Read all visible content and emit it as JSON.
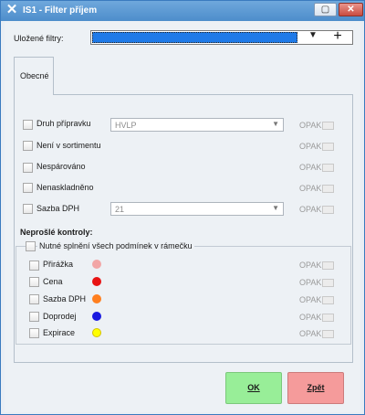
{
  "window": {
    "title": "IS1 - Filter příjem",
    "app_icon": "app-x-icon",
    "restore_icon": "restore-icon",
    "close_icon": "close-icon"
  },
  "saved_filters": {
    "label": "Uložené filtry:",
    "value": "",
    "dropdown_icon": "chevron-down-icon",
    "add_icon": "plus-icon"
  },
  "tabs": [
    {
      "label": "Obecné"
    }
  ],
  "opak_label": "OPAK",
  "general_filters": [
    {
      "label": "Druh přípravku",
      "combo": "HVLP"
    },
    {
      "label": "Není v sortimentu"
    },
    {
      "label": "Nespárováno"
    },
    {
      "label": "Nenaskladněno"
    },
    {
      "label": "Sazba DPH",
      "combo": "21"
    }
  ],
  "failed_checks": {
    "heading": "Neprošlé kontroly:",
    "group_label": "Nutné splnění všech podmínek v rámečku",
    "items": [
      {
        "label": "Přirážka",
        "color": "#f2a6a6"
      },
      {
        "label": "Cena",
        "color": "#e81313"
      },
      {
        "label": "Sazba DPH",
        "color": "#ff7f1f"
      },
      {
        "label": "Doprodej",
        "color": "#1a1ae0"
      },
      {
        "label": "Expirace",
        "color": "#ffff00"
      }
    ]
  },
  "buttons": {
    "ok": "OK",
    "back": "Zpět"
  }
}
